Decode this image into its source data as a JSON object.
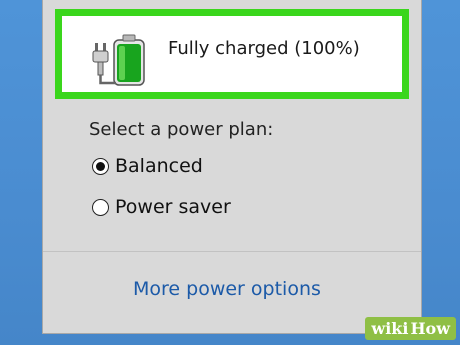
{
  "flyout": {
    "status_text": "Fully charged (100%)",
    "battery_level_percent": 100,
    "highlight_color": "#3ad61c",
    "plan_heading": "Select a power plan:",
    "plans": [
      {
        "label": "Balanced",
        "selected": true
      },
      {
        "label": "Power saver",
        "selected": false
      }
    ],
    "more_link": "More power options"
  },
  "watermark": {
    "wiki": "wiki",
    "how": "How"
  }
}
